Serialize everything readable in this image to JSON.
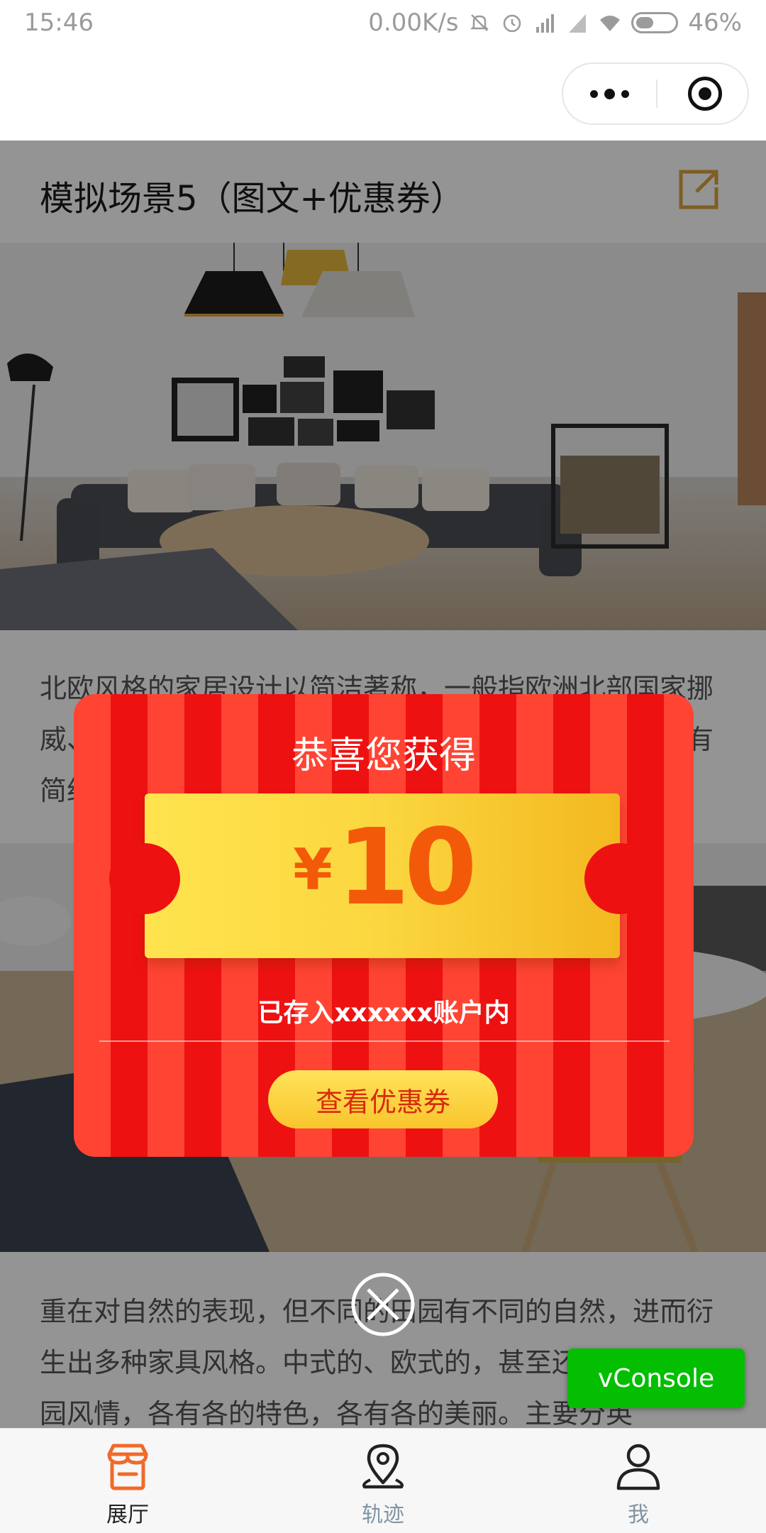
{
  "status_bar": {
    "time": "15:46",
    "network_speed": "0.00K/s",
    "battery": "46%",
    "battery_level": 0.46,
    "icons": [
      "mute-icon",
      "alarm-icon",
      "hd-signal-icon",
      "signal-icon",
      "wifi-icon",
      "battery-icon"
    ]
  },
  "nav": {
    "more_icon": "more-dots-icon",
    "close_icon": "target-close-icon"
  },
  "page": {
    "title": "模拟场景5（图文+优惠券）",
    "share_icon": "share-icon",
    "accent_color": "#d9a33b",
    "paragraph1": "北欧风格的家居设计以简洁著称，一般指欧洲北部国家挪威、丹麦、瑞典、芬兰及冰岛等国的艺术设计风格，具有简约、自然、人性化的特点。",
    "paragraph2": "重在对自然的表现，但不同的田园有不同的自然，进而衍生出多种家具风格。中式的、欧式的，甚至还有南亚的田园风情，各有各的特色，各有各的美丽。主要分英"
  },
  "coupon": {
    "heading": "恭喜您获得",
    "currency": "¥",
    "amount": "10",
    "stored_text": "已存入xxxxxx账户内",
    "button_label": "查看优惠券",
    "close_icon": "close-circle-icon",
    "stripe_colors": [
      "#ff4433",
      "#ee1111"
    ],
    "ticket_colors": [
      "#ffe44f",
      "#f3b820"
    ]
  },
  "tabbar": {
    "active_color": "#f06a2a",
    "inactive_color": "#7f95a5",
    "items": [
      {
        "label": "展厅",
        "icon": "store-icon",
        "active": true
      },
      {
        "label": "轨迹",
        "icon": "location-pin-icon",
        "active": false
      },
      {
        "label": "我",
        "icon": "user-icon",
        "active": false
      }
    ]
  },
  "vconsole": {
    "label": "vConsole"
  }
}
